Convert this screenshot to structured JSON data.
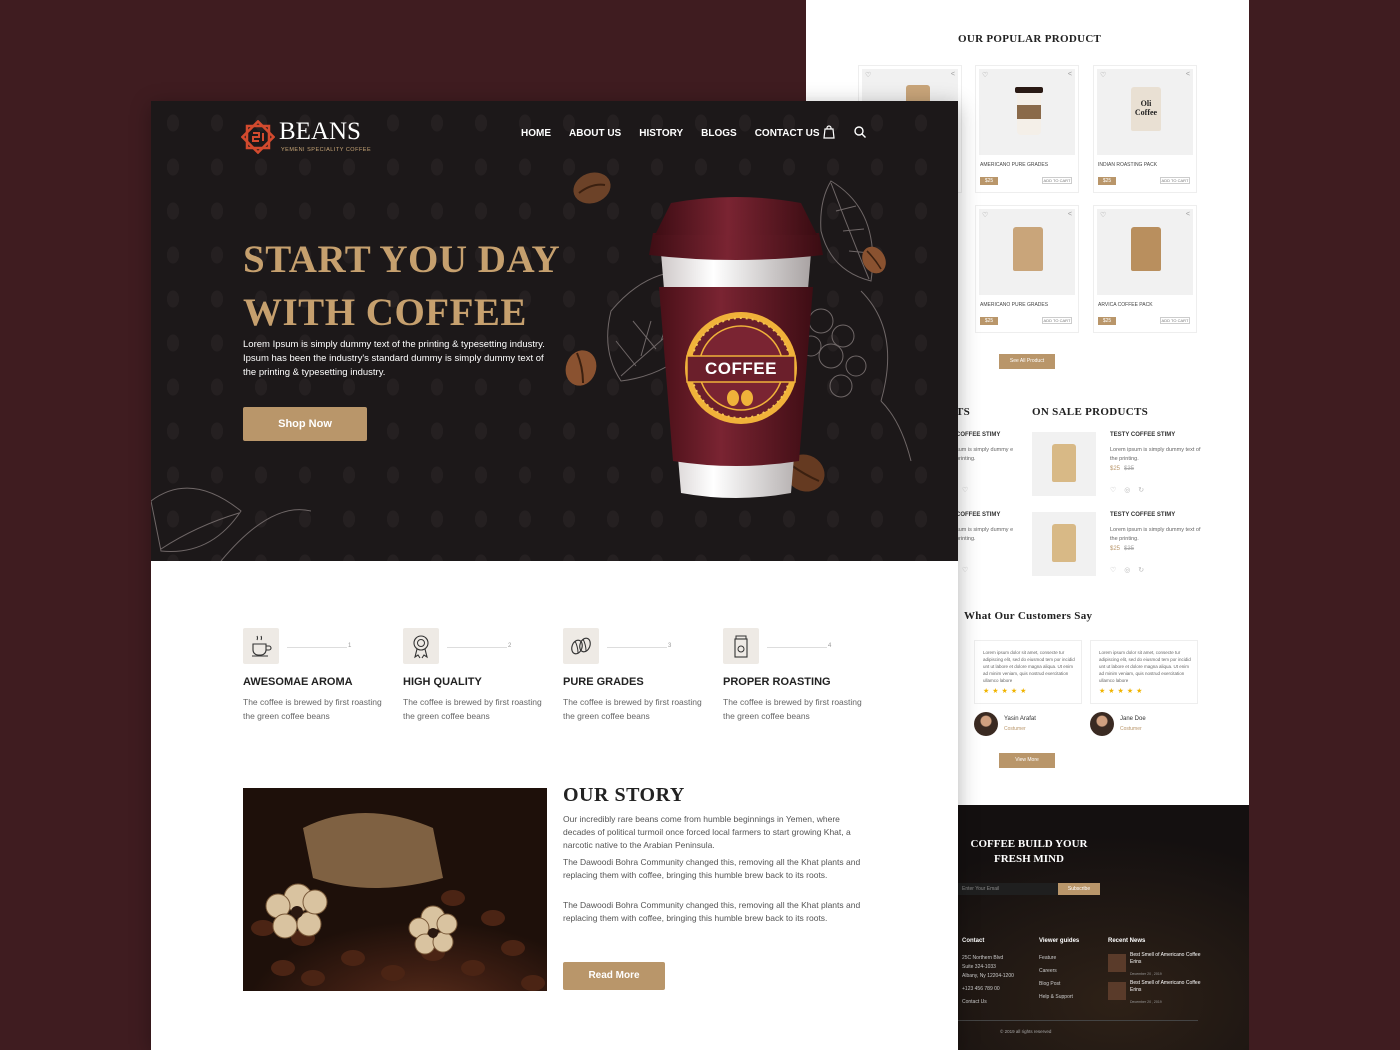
{
  "back": {
    "popular_title": "OUR POPULAR PRODUCT",
    "products": [
      {
        "name": "",
        "price": "",
        "cart": ""
      },
      {
        "name": "AMERICANO PURE GRADES",
        "price": "$25",
        "cart": "ADD TO CART"
      },
      {
        "name": "INDIAN ROASTING PACK",
        "price": "$25",
        "cart": "ADD TO CART",
        "label": "Oli Coffee"
      },
      {
        "name": "AMERICANO PURE GRADES",
        "price": "$25",
        "cart": "ADD TO CART"
      },
      {
        "name": "ARVICA COFFEE PACK",
        "price": "$25",
        "cart": "ADD TO CART"
      }
    ],
    "see_all": "See All Product",
    "left_partial_title": "TS",
    "sale_title": "ON SALE PRODUCTS",
    "sale_items": [
      {
        "title": "TESTY COFFEE STIMY",
        "desc": "Lorem ipsum is simply dummy text of the printing.",
        "price": "$25",
        "old_price": "$35"
      },
      {
        "title": "TESTY COFFEE STIMY",
        "desc": "Lorem ipsum is simply dummy text of the printing.",
        "price": "$25",
        "old_price": "$35"
      }
    ],
    "partial_sale": [
      {
        "title": "COFFEE STIMY",
        "desc": "sum is simply dummy e printing."
      },
      {
        "title": "COFFEE STIMY",
        "desc": "sum is simply dummy e printing."
      }
    ],
    "testimonial_title": "What Our Customers Say",
    "testimonials": [
      {
        "quote": "Lorem ipsum dolor sit amet, consecte tur adipiscing elit, sed do eiusmod tem por incidid unt ut labore et dolore magna aliqua. Ut enim ad minim veniam, quis nostrud exercitation ullamco labore",
        "stars": "★★★★★",
        "name": "Yasin Arafat",
        "role": "Costumer"
      },
      {
        "quote": "Lorem ipsum dolor sit amet, consecte tur adipiscing elit, sed do eiusmod tem por incidid unt ut labore et dolore magna aliqua. Ut enim ad minim veniam, quis nostrud exercitation ullamco labore",
        "stars": "★★★★★",
        "name": "Jane Doe",
        "role": "Costumer"
      }
    ],
    "view_more": "View More",
    "footer": {
      "title": "COFFEE BUILD YOUR FRESH MIND",
      "email_placeholder": "Enter Your Email",
      "subscribe": "Subscribe",
      "contact_head": "Contact",
      "contact_lines": [
        "25C Northern Blvd",
        "Suite 324-1033",
        "Albany, Ny 12204-1200",
        "+123 456 789 00",
        "Contact Us"
      ],
      "guides_head": "Viewer guides",
      "guides": [
        "Feature",
        "Careers",
        "Blog Post",
        "Help & Support"
      ],
      "news_head": "Recent News",
      "news": [
        {
          "title": "Best Smell of Americano Coffee Erins",
          "date": "December 20 , 2019"
        },
        {
          "title": "Best Smell of Americano Coffee Erins",
          "date": "December 20 , 2019"
        }
      ],
      "copyright": "© 2019 all rights reserved"
    }
  },
  "front": {
    "logo": {
      "text": "BEANS",
      "sub": "YEMENI SPECIALITY COFFEE"
    },
    "nav": [
      "HOME",
      "ABOUT US",
      "HISTORY",
      "BLOGS",
      "CONTACT US"
    ],
    "icons": [
      "shopping-bag-icon",
      "search-icon"
    ],
    "hero": {
      "title_line1": "START YOU DAY",
      "title_line2": "WITH COFFEE",
      "text": "Lorem Ipsum is simply dummy text of the printing & typesetting industry. Ipsum has been the industry's standard dummy is simply dummy text of the printing & typesetting industry.",
      "button": "Shop Now",
      "cup_label": "COFFEE"
    },
    "features": [
      {
        "num": "1",
        "title": "AWESOMAE AROMA",
        "desc": "The coffee is brewed by first roasting the green coffee beans",
        "icon": "coffee-cup-icon"
      },
      {
        "num": "2",
        "title": "HIGH QUALITY",
        "desc": "The coffee is brewed by first roasting the green coffee beans",
        "icon": "award-badge-icon"
      },
      {
        "num": "3",
        "title": "PURE GRADES",
        "desc": "The coffee is brewed by first roasting the green coffee beans",
        "icon": "coffee-beans-icon"
      },
      {
        "num": "4",
        "title": "PROPER ROASTING",
        "desc": "The coffee is brewed by first roasting the green coffee beans",
        "icon": "coffee-pack-icon"
      }
    ],
    "story": {
      "title": "OUR STORY",
      "paragraphs": [
        "Our incredibly rare beans come from humble beginnings in Yemen, where decades of political turmoil once forced local farmers to start growing Khat, a narcotic native to the Arabian Peninsula.",
        "The Dawoodi Bohra Community changed this, removing all the Khat plants and replacing them with coffee, bringing this humble brew back to its roots.",
        "The Dawoodi Bohra Community changed this, removing all the Khat plants and replacing them with coffee, bringing this humble brew back to its roots."
      ],
      "button": "Read More"
    }
  },
  "colors": {
    "accent": "#b9966a",
    "hero_bg": "#1c1819",
    "page_bg": "#3f1c20",
    "cup": "#6b1f2b"
  }
}
